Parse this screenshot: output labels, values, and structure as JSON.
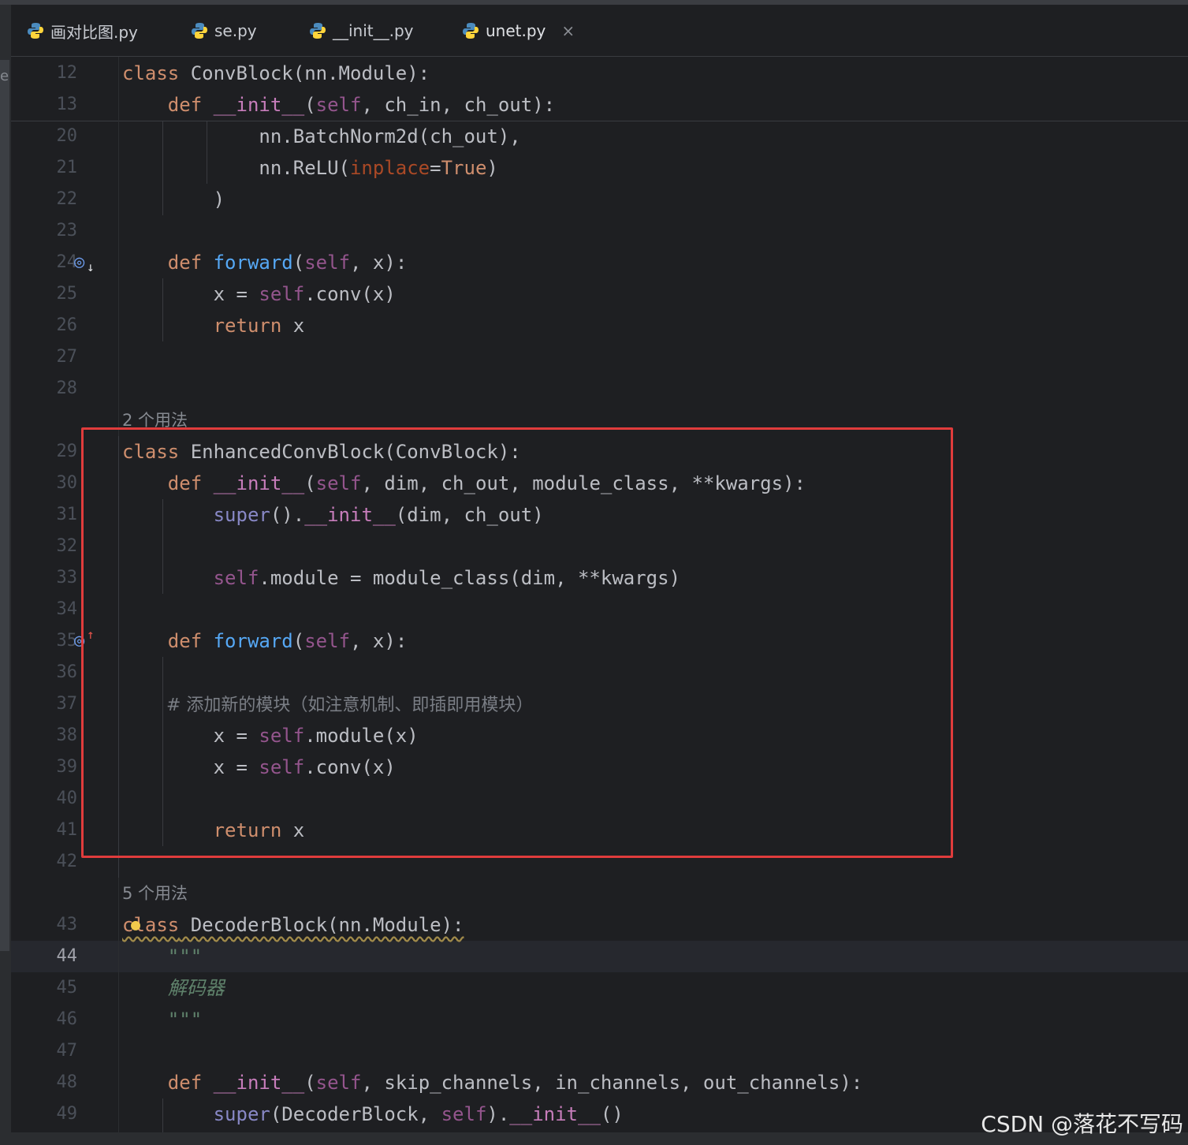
{
  "tabs": [
    {
      "label": "画对比图.py"
    },
    {
      "label": "se.py"
    },
    {
      "label": "__init__.py"
    },
    {
      "label": "unet.py",
      "close": "×"
    }
  ],
  "hints": {
    "h1": "2 个用法",
    "h2": "5 个用法"
  },
  "lines": {
    "n12": "12",
    "n13": "13",
    "n20": "20",
    "n21": "21",
    "n22": "22",
    "n23": "23",
    "n24": "24",
    "n25": "25",
    "n26": "26",
    "n27": "27",
    "n28": "28",
    "n29": "29",
    "n30": "30",
    "n31": "31",
    "n32": "32",
    "n33": "33",
    "n34": "34",
    "n35": "35",
    "n36": "36",
    "n37": "37",
    "n38": "38",
    "n39": "39",
    "n40": "40",
    "n41": "41",
    "n42": "42",
    "n43": "43",
    "n44": "44",
    "n45": "45",
    "n46": "46",
    "n47": "47",
    "n48": "48",
    "n49": "49"
  },
  "code": {
    "l12": "class ConvBlock(nn.Module):",
    "l13": "    def __init__(self, ch_in, ch_out):",
    "l20": "            nn.BatchNorm2d(ch_out),",
    "l21": "            nn.ReLU(inplace=True)",
    "l22": "        )",
    "l24": "    def forward(self, x):",
    "l25": "        x = self.conv(x)",
    "l26": "        return x",
    "l29": "class EnhancedConvBlock(ConvBlock):",
    "l30": "    def __init__(self, dim, ch_out, module_class, **kwargs):",
    "l31": "        super().__init__(dim, ch_out)",
    "l33": "        self.module = module_class(dim, **kwargs)",
    "l35": "    def forward(self, x):",
    "l37": "        # 添加新的模块（如注意机制、即插即用模块）",
    "l38": "        x = self.module(x)",
    "l39": "        x = self.conv(x)",
    "l41": "        return x",
    "l43": "class DecoderBlock(nn.Module):",
    "l44": "    \"\"\"",
    "l45": "    解码器",
    "l46": "    \"\"\"",
    "l48": "    def __init__(self, skip_channels, in_channels, out_channels):",
    "l49": "        super(DecoderBlock, self).__init__()"
  },
  "left_panel_glyph": "e",
  "watermark": "CSDN @落花不写码",
  "icons": {
    "tab_file": "python-icon",
    "gutter_impl_down": "implemented-by-icon",
    "gutter_override_up": "overrides-icon",
    "intention": "lightbulb-icon"
  },
  "colors": {
    "highlight_box": "#e03c3c",
    "keyword": "#cf8e6d",
    "function": "#56a8f5",
    "self": "#94558d",
    "dunder": "#c77dbb"
  }
}
